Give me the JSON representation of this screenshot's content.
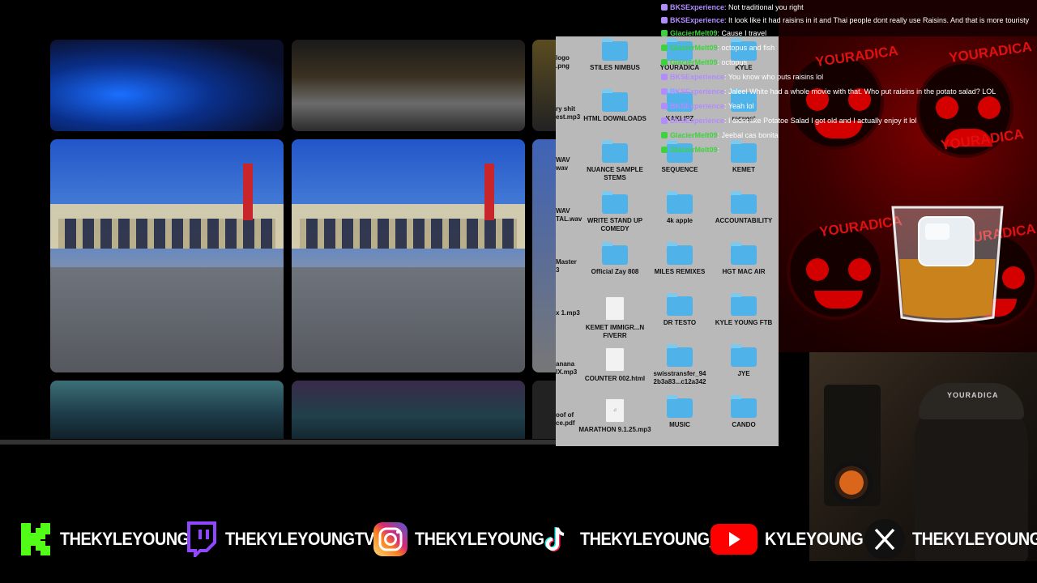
{
  "photos": {
    "items": [
      {
        "name": "night-pool"
      },
      {
        "name": "night-street"
      },
      {
        "name": "pavilion-1"
      },
      {
        "name": "pavilion-2"
      },
      {
        "name": "arena-1"
      },
      {
        "name": "arena-2"
      }
    ]
  },
  "finder": {
    "edge_labels": [
      "logo\n.png",
      "ry shit\nest.mp3",
      "WAV\nwav",
      "WAV\nTAL.wav",
      "Master\n3",
      "x 1.mp3",
      "anana\nIX.mp3",
      "oof of\nce.pdf"
    ],
    "items": [
      {
        "label": "STILES NIMBUS",
        "kind": "folder"
      },
      {
        "label": "YOURADICA",
        "kind": "folder"
      },
      {
        "label": "KYLE",
        "kind": "folder"
      },
      {
        "label": "HTML DOWNLOADS",
        "kind": "folder"
      },
      {
        "label": "KAKLIPZ",
        "kind": "folder"
      },
      {
        "label": "request",
        "kind": "folder"
      },
      {
        "label": "NUANCE SAMPLE STEMS",
        "kind": "folder"
      },
      {
        "label": "SEQUENCE",
        "kind": "folder"
      },
      {
        "label": "KEMET",
        "kind": "folder"
      },
      {
        "label": "WRITE STAND UP COMEDY",
        "kind": "folder"
      },
      {
        "label": "4k apple",
        "kind": "folder"
      },
      {
        "label": "ACCOUNTABILITY",
        "kind": "folder"
      },
      {
        "label": "Official Zay 808",
        "kind": "folder"
      },
      {
        "label": "MILES REMIXES",
        "kind": "folder"
      },
      {
        "label": "HGT MAC AIR",
        "kind": "folder"
      },
      {
        "label": "KEMET IMMIGR...N FIVERR",
        "kind": "doc"
      },
      {
        "label": "DR TESTO",
        "kind": "folder"
      },
      {
        "label": "KYLE YOUNG FTB",
        "kind": "folder"
      },
      {
        "label": "COUNTER 002.html",
        "kind": "doc"
      },
      {
        "label": "swisstransfer_94 2b3a83...c12a342",
        "kind": "folder"
      },
      {
        "label": "JYE",
        "kind": "folder"
      },
      {
        "label": "MARATHON 9.1.25.mp3",
        "kind": "audio"
      },
      {
        "label": "MUSIC",
        "kind": "folder"
      },
      {
        "label": "CANDO",
        "kind": "folder"
      }
    ]
  },
  "chat": {
    "messages": [
      {
        "user": "BKSExperience",
        "text": "Not traditional you right",
        "color": "bks"
      },
      {
        "user": "BKSExperience",
        "text": "It look like it had raisins in it and Thai people dont really use Raisins. And that is more touristy",
        "color": "bks"
      },
      {
        "user": "GlacierMelt09",
        "text": "Cause I travel",
        "color": "glacier"
      },
      {
        "user": "GlacierMelt09",
        "text": "octopus and fish",
        "color": "glacier"
      },
      {
        "user": "GlacierMelt09",
        "text": "octopus",
        "color": "glacier"
      },
      {
        "user": "BKSExperience",
        "text": "You know who puts raisins lol",
        "color": "bks"
      },
      {
        "user": "BKSExperience",
        "text": "Jaleel White had a whole movie with that. Who put raisins in the potato salad? LOL",
        "color": "bks"
      },
      {
        "user": "BKSExperience",
        "text": "Yeah lol",
        "color": "bks"
      },
      {
        "user": "BKSExperience",
        "text": "I didnt like Potatoe Salad I got old and I actually enjoy it lol",
        "color": "bks"
      },
      {
        "user": "GlacierMelt09",
        "text": "Jeebal cas bonita",
        "color": "glacier"
      },
      {
        "user": "GlacierMelt09",
        "text": "",
        "color": "glacier"
      }
    ]
  },
  "overlay": {
    "brand_words": [
      "YOURADICA",
      "YOURADICA",
      "YOURADICA",
      "YOURADICA",
      "YOURADICA"
    ],
    "cap_text": "YOURADICA"
  },
  "socials": {
    "kick": "THEKYLEYOUNG",
    "twitch": "THEKYLEYOUNGTV",
    "instagram": "THEKYLEYOUNG",
    "tiktok": "THEKYLEYOUNG_",
    "youtube": "KYLEYOUNG",
    "x": "THEKYLEYOUNG"
  },
  "colors": {
    "bks": "#b28cff",
    "glacier": "#3fd23f",
    "folder": "#4fb2e8",
    "kick": "#53fc18",
    "twitch": "#9146ff",
    "youtube": "#ff0000"
  }
}
